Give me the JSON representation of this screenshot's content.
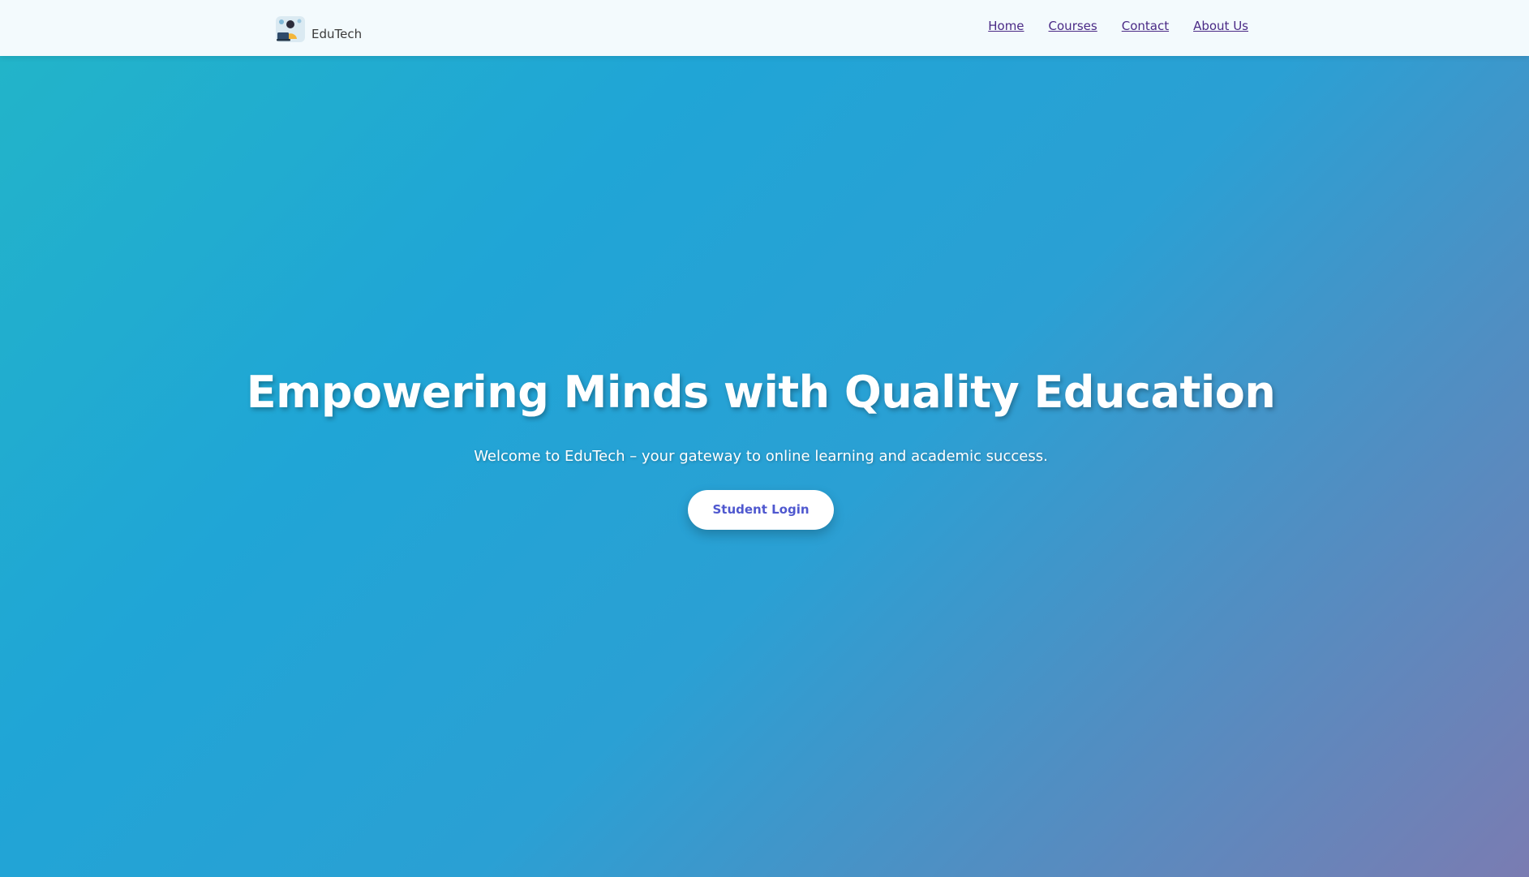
{
  "header": {
    "brand": {
      "name": "EduTech",
      "logo_icon": "student-laptop-logo-icon"
    },
    "nav": [
      {
        "label": "Home"
      },
      {
        "label": "Courses"
      },
      {
        "label": "Contact"
      },
      {
        "label": "About Us"
      }
    ]
  },
  "hero": {
    "title": "Empowering Minds with Quality Education",
    "subtitle": "Welcome to EduTech – your gateway to online learning and academic success.",
    "cta_label": "Student Login"
  },
  "colors": {
    "header_bg": "#f3fafd",
    "nav_link": "#4a2a86",
    "hero_gradient_start": "#22b4c9",
    "hero_gradient_end": "#7a7cb2",
    "cta_text": "#4f58cf"
  }
}
